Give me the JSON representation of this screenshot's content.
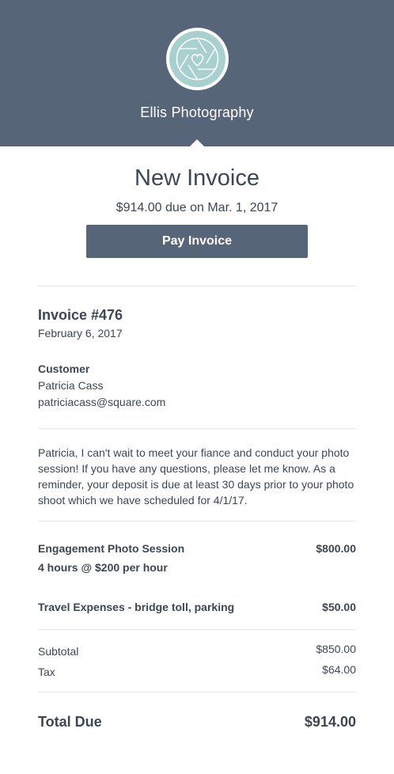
{
  "header": {
    "business_name": "Ellis Photography",
    "logo_icon": "camera-aperture-heart-icon",
    "background_color": "#566578",
    "logo_color": "#a8d0cf"
  },
  "invoice": {
    "title": "New Invoice",
    "due_line": "$914.00 due on Mar. 1, 2017",
    "pay_button_label": "Pay Invoice",
    "number": "Invoice #476",
    "date": "February 6, 2017"
  },
  "customer": {
    "label": "Customer",
    "name": "Patricia Cass",
    "email": "patriciacass@square.com"
  },
  "message": "Patricia, I can't wait to meet your fiance and conduct your photo session! If you have any questions, please let me know. As a reminder, your deposit is due at least 30 days prior to your photo shoot which we have scheduled for 4/1/17.",
  "line_items": [
    {
      "name": "Engagement Photo Session",
      "detail": "4 hours @ $200 per hour",
      "amount": "$800.00"
    },
    {
      "name": "Travel Expenses - bridge toll, parking",
      "amount": "$50.00"
    }
  ],
  "summary": {
    "subtotal_label": "Subtotal",
    "subtotal_amount": "$850.00",
    "tax_label": "Tax",
    "tax_amount": "$64.00",
    "total_label": "Total Due",
    "total_amount": "$914.00"
  }
}
